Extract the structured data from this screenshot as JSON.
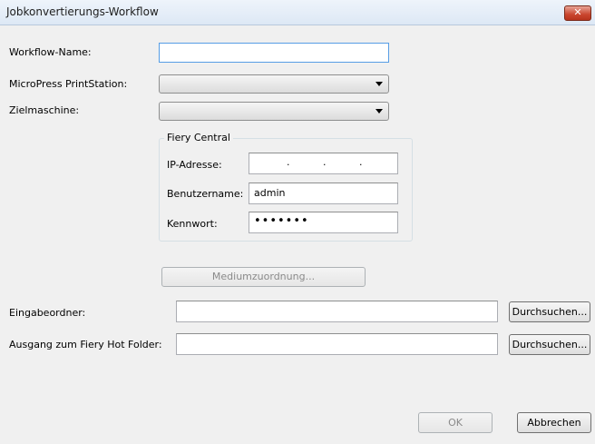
{
  "window": {
    "title": "Jobkonvertierungs-Workflow",
    "close_glyph": "✕"
  },
  "form": {
    "workflow_name_label": "Workflow-Name:",
    "workflow_name_value": "",
    "printstation_label": "MicroPress PrintStation:",
    "printstation_value": "",
    "target_machine_label": "Zielmaschine:",
    "target_machine_value": ""
  },
  "fiery_central": {
    "legend": "Fiery Central",
    "ip_label": "IP-Adresse:",
    "ip_dots": [
      ".",
      ".",
      "."
    ],
    "username_label": "Benutzername:",
    "username_value": "admin",
    "password_label": "Kennwort:",
    "password_value": "•••••••"
  },
  "media_mapping_button": "Mediumzuordnung...",
  "folders": {
    "input_label": "Eingabeordner:",
    "input_value": "",
    "output_label": "Ausgang zum Fiery Hot Folder:",
    "output_value": "",
    "browse_label": "Durchsuchen..."
  },
  "footer": {
    "ok_label": "OK",
    "cancel_label": "Abbrechen"
  }
}
